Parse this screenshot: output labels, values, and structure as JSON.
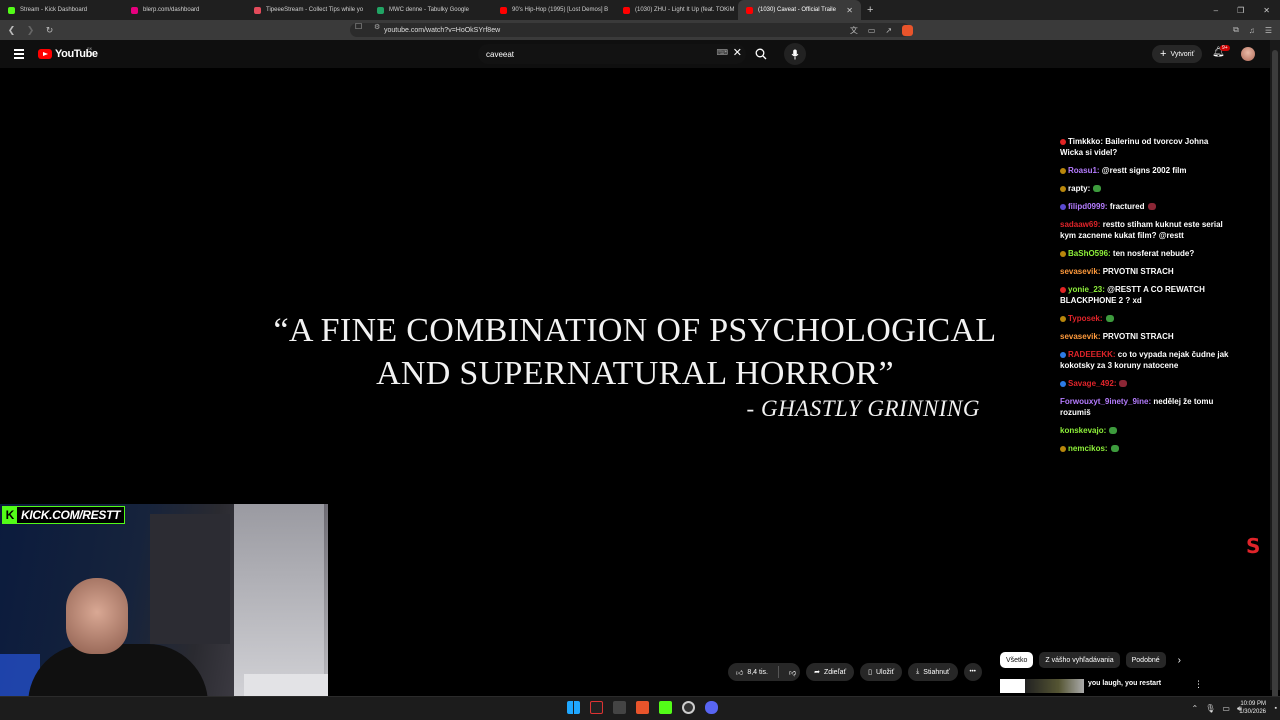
{
  "browser": {
    "tabs": [
      {
        "label": "Stream - Kick Dashboard",
        "color": "#53fc18",
        "active": false
      },
      {
        "label": "blerp.com/dashboard",
        "color": "#e6007e",
        "active": false
      },
      {
        "label": "TipeeeStream - Collect Tips while yo",
        "color": "#e34b5b",
        "active": false
      },
      {
        "label": "MWC denne - Tabulky Google",
        "color": "#21a464",
        "active": false
      },
      {
        "label": "90's Hip-Hop (1995) [Lost Demos] B",
        "color": "#ff0000",
        "active": false
      },
      {
        "label": "(1030) ZHU - Light It Up (feat. TOKiM",
        "color": "#ff0000",
        "active": false
      },
      {
        "label": "(1030) Caveat - Official Traile",
        "color": "#ff0000",
        "active": true
      }
    ],
    "new_tab": "+",
    "window_controls": [
      "–",
      "❐",
      "✕"
    ],
    "url": "youtube.com/watch?v=HoOkSYrf8ew"
  },
  "youtube": {
    "logo_text": "YouTube",
    "country_code": "SK",
    "search_value": "caveeat",
    "create_label": "Vytvoriť",
    "notification_count": "9+"
  },
  "video": {
    "quote": "“A FINE COMBINATION OF PSYCHOLOGICAL AND SUPERNATURAL HORROR”",
    "quote_source": "- GHASTLY GRINNING"
  },
  "chat": [
    {
      "user": "Timkkko:",
      "text": "Bailerinu od tvorcov Johna Wicka si videl?",
      "user_color": "#ffffff",
      "badge_color": "#e02424",
      "emote": ""
    },
    {
      "user": "Roasu1:",
      "text": "@restt signs 2002 film",
      "user_color": "#b57cff",
      "badge_color": "#b8860b",
      "emote": ""
    },
    {
      "user": "rapty:",
      "text": "",
      "user_color": "#ffffff",
      "badge_color": "#b8860b",
      "emote": "green"
    },
    {
      "user": "filipd0999:",
      "text": "fractured",
      "user_color": "#b57cff",
      "badge_color": "#5a4bd1",
      "emote": "red"
    },
    {
      "user": "sadaaw69:",
      "text": "restto stiham kuknut este serial kym zacneme kukat film? @restt",
      "user_color": "#e0242a",
      "badge_color": "",
      "emote": ""
    },
    {
      "user": "BaShO596:",
      "text": "ten nosferat nebude?",
      "user_color": "#8ef03a",
      "badge_color": "#b8860b",
      "emote": ""
    },
    {
      "user": "sevasevik:",
      "text": "PRVOTNI STRACH",
      "user_color": "#ff9a3c",
      "badge_color": "",
      "emote": ""
    },
    {
      "user": "yonie_23:",
      "text": "@RESTT A CO REWATCH BLACKPHONE 2 ? xd",
      "user_color": "#8ef03a",
      "badge_color": "#e02424",
      "emote": ""
    },
    {
      "user": "Typosek:",
      "text": "",
      "user_color": "#e0242a",
      "badge_color": "#b8860b",
      "emote": "green"
    },
    {
      "user": "sevasevik:",
      "text": "PRVOTNI STRACH",
      "user_color": "#ff9a3c",
      "badge_color": "",
      "emote": ""
    },
    {
      "user": "RADEEEKK:",
      "text": "co to vypada nejak čudne jak kokotsky za 3 koruny natocene",
      "user_color": "#e0242a",
      "badge_color": "#2c7be5",
      "emote": ""
    },
    {
      "user": "Savage_492:",
      "text": "",
      "user_color": "#e0242a",
      "badge_color": "#2c7be5",
      "emote": "red"
    },
    {
      "user": "Forwouxyt_9inety_9ine:",
      "text": "nedělej že tomu rozumiš",
      "user_color": "#b57cff",
      "badge_color": "",
      "emote": ""
    },
    {
      "user": "konskevajo:",
      "text": "",
      "user_color": "#8ef03a",
      "badge_color": "",
      "emote": "green"
    },
    {
      "user": "nemcikos:",
      "text": "",
      "user_color": "#8ef03a",
      "badge_color": "#b8860b",
      "emote": "green"
    }
  ],
  "overlay": {
    "kick_url": "KICK.COM/RESTT",
    "kick_k": "K"
  },
  "actions": {
    "likes": "8,4 tis.",
    "share": "Zdieľať",
    "save": "Uložiť",
    "download": "Stiahnuť",
    "more": "•••"
  },
  "chips": [
    "Všetko",
    "Z vášho vyhľadávania",
    "Podobné"
  ],
  "recommendation": {
    "title": "you laugh, you restart"
  },
  "taskbar": {
    "time": "10:09 PM",
    "date": "1/30/2026"
  }
}
